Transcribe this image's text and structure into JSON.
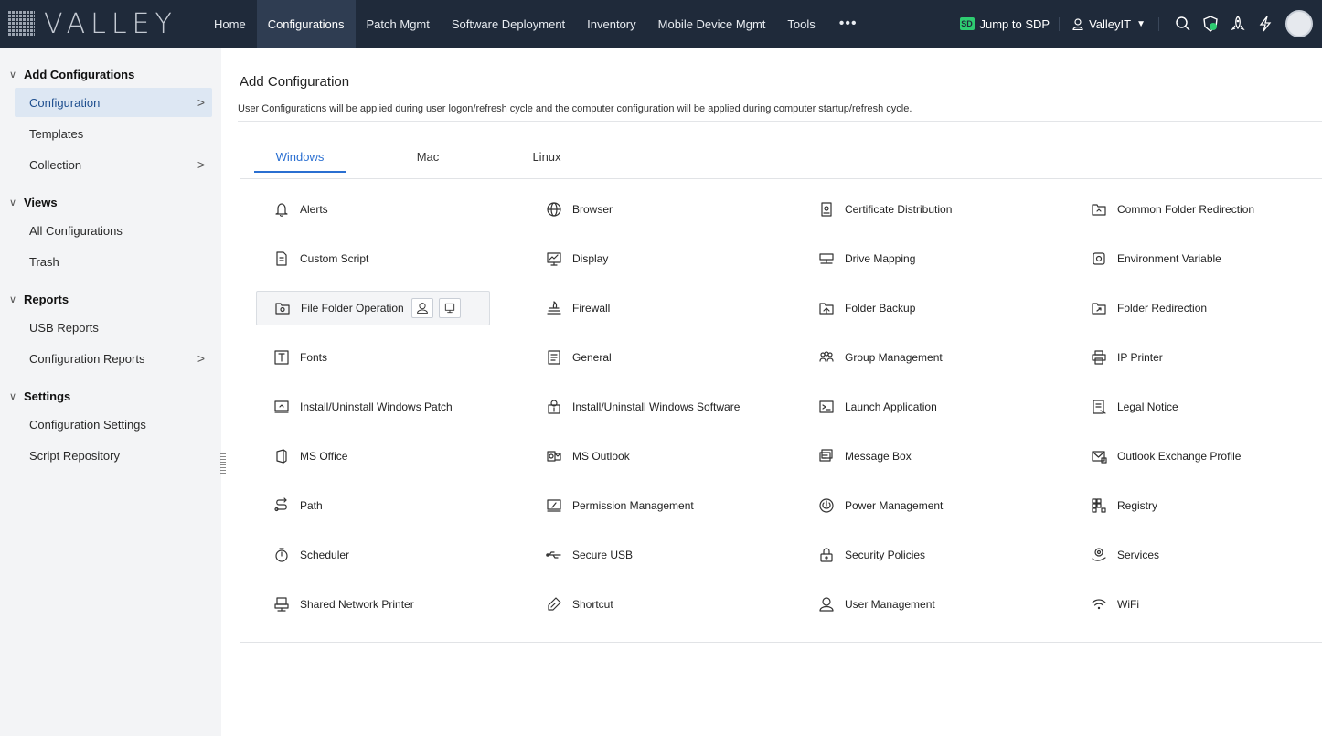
{
  "brand": {
    "name": "VALLEY"
  },
  "nav": {
    "items": [
      "Home",
      "Configurations",
      "Patch Mgmt",
      "Software Deployment",
      "Inventory",
      "Mobile Device Mgmt",
      "Tools"
    ],
    "active": "Configurations",
    "more": "•••"
  },
  "topbar": {
    "jump_label": "Jump to SDP",
    "jump_badge": "SD",
    "user_label": "ValleyIT",
    "icons": [
      "search-icon",
      "shield-status-icon",
      "rocket-icon",
      "lightning-icon",
      "avatar"
    ]
  },
  "sidebar": {
    "sections": [
      {
        "title": "Add Configurations",
        "items": [
          {
            "label": "Configuration",
            "arrow": ">",
            "active": true
          },
          {
            "label": "Templates",
            "arrow": ""
          },
          {
            "label": "Collection",
            "arrow": ">"
          }
        ]
      },
      {
        "title": "Views",
        "items": [
          {
            "label": "All Configurations",
            "arrow": ""
          },
          {
            "label": "Trash",
            "arrow": ""
          }
        ]
      },
      {
        "title": "Reports",
        "items": [
          {
            "label": "USB Reports",
            "arrow": ""
          },
          {
            "label": "Configuration Reports",
            "arrow": ">"
          }
        ]
      },
      {
        "title": "Settings",
        "items": [
          {
            "label": "Configuration Settings",
            "arrow": ""
          },
          {
            "label": "Script Repository",
            "arrow": ""
          }
        ]
      }
    ]
  },
  "main": {
    "title": "Add Configuration",
    "description": "User Configurations will be applied during user logon/refresh cycle and the computer configuration will be applied during computer startup/refresh cycle.",
    "tabs": [
      "Windows",
      "Mac",
      "Linux"
    ],
    "active_tab": "Windows",
    "configs": [
      {
        "label": "Alerts",
        "icon": "bell-icon"
      },
      {
        "label": "Browser",
        "icon": "globe-icon"
      },
      {
        "label": "Certificate Distribution",
        "icon": "certificate-icon"
      },
      {
        "label": "Common Folder Redirection",
        "icon": "folder-redirect-icon"
      },
      {
        "label": "Custom Script",
        "icon": "script-icon"
      },
      {
        "label": "Display",
        "icon": "monitor-icon"
      },
      {
        "label": "Drive Mapping",
        "icon": "drive-icon"
      },
      {
        "label": "Environment Variable",
        "icon": "env-variable-icon"
      },
      {
        "label": "File Folder Operation",
        "icon": "folder-gear-icon",
        "hovered": true,
        "user_icon": "user-icon",
        "computer_icon": "computer-icon"
      },
      {
        "label": "Firewall",
        "icon": "firewall-icon"
      },
      {
        "label": "Folder Backup",
        "icon": "folder-backup-icon"
      },
      {
        "label": "Folder Redirection",
        "icon": "folder-arrow-icon"
      },
      {
        "label": "Fonts",
        "icon": "font-icon"
      },
      {
        "label": "General",
        "icon": "document-icon"
      },
      {
        "label": "Group Management",
        "icon": "group-icon"
      },
      {
        "label": "IP Printer",
        "icon": "printer-icon"
      },
      {
        "label": "Install/Uninstall Windows Patch",
        "icon": "patch-icon"
      },
      {
        "label": "Install/Uninstall Windows Software",
        "icon": "software-package-icon"
      },
      {
        "label": "Launch Application",
        "icon": "terminal-icon"
      },
      {
        "label": "Legal Notice",
        "icon": "legal-notice-icon"
      },
      {
        "label": "MS Office",
        "icon": "ms-office-icon"
      },
      {
        "label": "MS Outlook",
        "icon": "ms-outlook-icon"
      },
      {
        "label": "Message Box",
        "icon": "message-box-icon"
      },
      {
        "label": "Outlook Exchange Profile",
        "icon": "mail-icon"
      },
      {
        "label": "Path",
        "icon": "path-icon"
      },
      {
        "label": "Permission Management",
        "icon": "permission-icon"
      },
      {
        "label": "Power Management",
        "icon": "power-icon"
      },
      {
        "label": "Registry",
        "icon": "registry-icon"
      },
      {
        "label": "Scheduler",
        "icon": "timer-icon"
      },
      {
        "label": "Secure USB",
        "icon": "usb-icon"
      },
      {
        "label": "Security Policies",
        "icon": "lock-icon"
      },
      {
        "label": "Services",
        "icon": "services-icon"
      },
      {
        "label": "Shared Network Printer",
        "icon": "network-printer-icon"
      },
      {
        "label": "Shortcut",
        "icon": "shortcut-icon"
      },
      {
        "label": "User Management",
        "icon": "user-icon"
      },
      {
        "label": "WiFi",
        "icon": "wifi-icon"
      }
    ]
  },
  "colors": {
    "topbar": "#1f2a3a",
    "accent": "#2a6fd1",
    "sidebar_bg": "#f3f4f6",
    "active_item_bg": "#dde7f3"
  }
}
